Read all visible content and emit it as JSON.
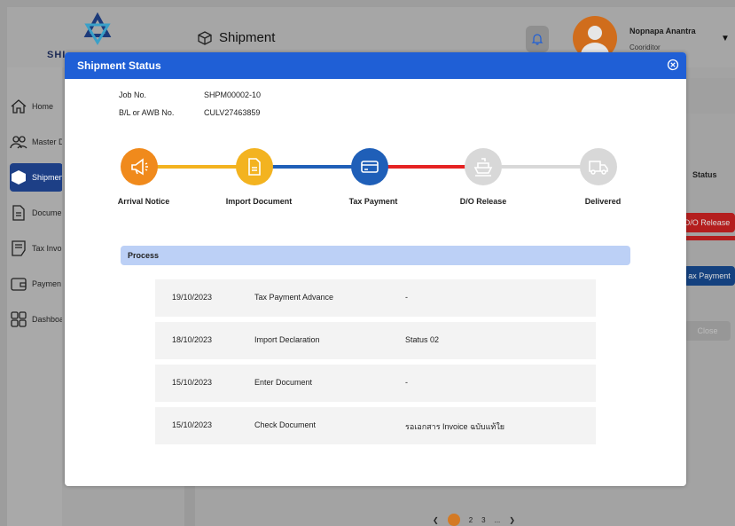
{
  "header": {
    "logo_text": "SHI",
    "page_title": "Shipment",
    "user_name": "Nopnapa Anantra",
    "user_role": "Cooriditor"
  },
  "sidebar": {
    "items": [
      {
        "label": "Home",
        "icon": "home-icon"
      },
      {
        "label": "Master D",
        "icon": "users-icon"
      },
      {
        "label": "Shipmen",
        "icon": "box-icon",
        "active": true
      },
      {
        "label": "Docume",
        "icon": "document-icon"
      },
      {
        "label": "Tax Invo",
        "icon": "invoice-icon"
      },
      {
        "label": "Paymen",
        "icon": "wallet-icon"
      },
      {
        "label": "Dashboa",
        "icon": "dashboard-icon"
      }
    ]
  },
  "background": {
    "status_header": "Status",
    "do_release_btn": "D/O Release",
    "tax_payment_btn": "ax Payment",
    "close_btn": "Close",
    "pagination": [
      "2",
      "3",
      "..."
    ],
    "current_page": "1"
  },
  "modal": {
    "title": "Shipment Status",
    "job_no_label": "Job No.",
    "job_no_value": "SHPM00002-10",
    "bl_label": "B/L or AWB No.",
    "bl_value": "CULV27463859",
    "steps": [
      {
        "label": "Arrival Notice",
        "icon": "megaphone-icon",
        "color": "#f08a1c"
      },
      {
        "label": "Import Document",
        "icon": "document-icon",
        "color": "#f3b320"
      },
      {
        "label": "Tax Payment",
        "icon": "card-icon",
        "color": "#1f5fb8"
      },
      {
        "label": "D/O Release",
        "icon": "ship-icon",
        "color": "#d8d8d8"
      },
      {
        "label": "Delivered",
        "icon": "truck-icon",
        "color": "#d8d8d8"
      }
    ],
    "process_label": "Process",
    "process_rows": [
      {
        "date": "19/10/2023",
        "activity": "Tax Payment Advance",
        "note": "-"
      },
      {
        "date": "18/10/2023",
        "activity": "Import Declaration",
        "note": "Status 02"
      },
      {
        "date": "15/10/2023",
        "activity": "Enter Document",
        "note": "-"
      },
      {
        "date": "15/10/2023",
        "activity": "Check Document",
        "note": "รอเอกสาร Invoice ฉบับแท้ใย"
      }
    ]
  },
  "colors": {
    "modal_header": "#1f5fd6",
    "process_bar": "#bcd0f6",
    "line_orange_yellow": "#f3b320",
    "line_blue": "#1f5fb8",
    "line_red": "#e52222",
    "line_grey": "#d8d8d8"
  }
}
